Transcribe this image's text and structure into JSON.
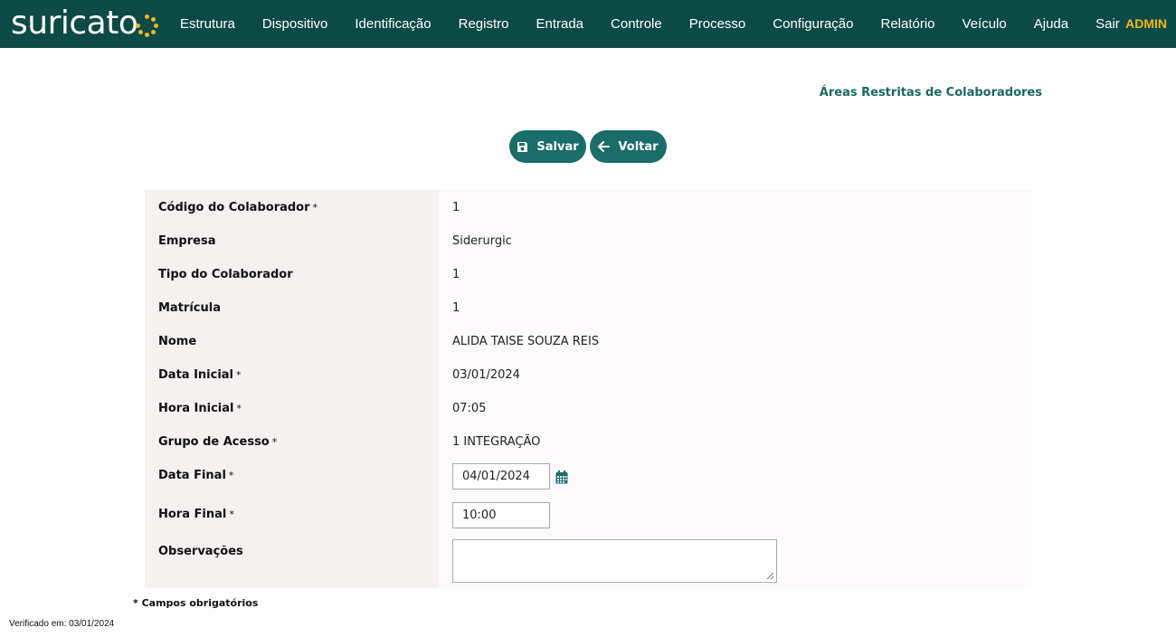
{
  "brand": {
    "logo_text": "suricato",
    "accent": "#f2b51c",
    "nav_bg": "#0c4a46"
  },
  "nav": {
    "items": [
      "Estrutura",
      "Dispositivo",
      "Identificação",
      "Registro",
      "Entrada",
      "Controle",
      "Processo",
      "Configuração",
      "Relatório",
      "Veículo",
      "Ajuda",
      "Sair"
    ],
    "user": "ADMIN"
  },
  "page": {
    "title": "Áreas Restritas de Colaboradores"
  },
  "toolbar": {
    "save_label": "Salvar",
    "save_icon": "floppy-disk-icon",
    "back_label": "Voltar",
    "back_icon": "arrow-left-icon"
  },
  "form": {
    "required_mark": "*",
    "fields": [
      {
        "label": "Código do Colaborador",
        "required": true,
        "value": "1"
      },
      {
        "label": "Empresa",
        "required": false,
        "value": "Siderurgic"
      },
      {
        "label": "Tipo do Colaborador",
        "required": false,
        "value": "1"
      },
      {
        "label": "Matrícula",
        "required": false,
        "value": "1"
      },
      {
        "label": "Nome",
        "required": false,
        "value": "ALIDA TAISE SOUZA REIS"
      },
      {
        "label": "Data Inicial",
        "required": true,
        "value": "03/01/2024"
      },
      {
        "label": "Hora Inicial",
        "required": true,
        "value": "07:05"
      },
      {
        "label": "Grupo de Acesso",
        "required": true,
        "value": "1 INTEGRAÇÃO"
      },
      {
        "label": "Data Final",
        "required": true,
        "value": "04/01/2024",
        "icon": "calendar-icon"
      },
      {
        "label": "Hora Final",
        "required": true,
        "value": "10:00"
      },
      {
        "label": "Observações",
        "required": false,
        "value": ""
      }
    ]
  },
  "footer": {
    "required_note": "* Campos obrigatórios",
    "verified": "Verificado em: 03/01/2024"
  }
}
